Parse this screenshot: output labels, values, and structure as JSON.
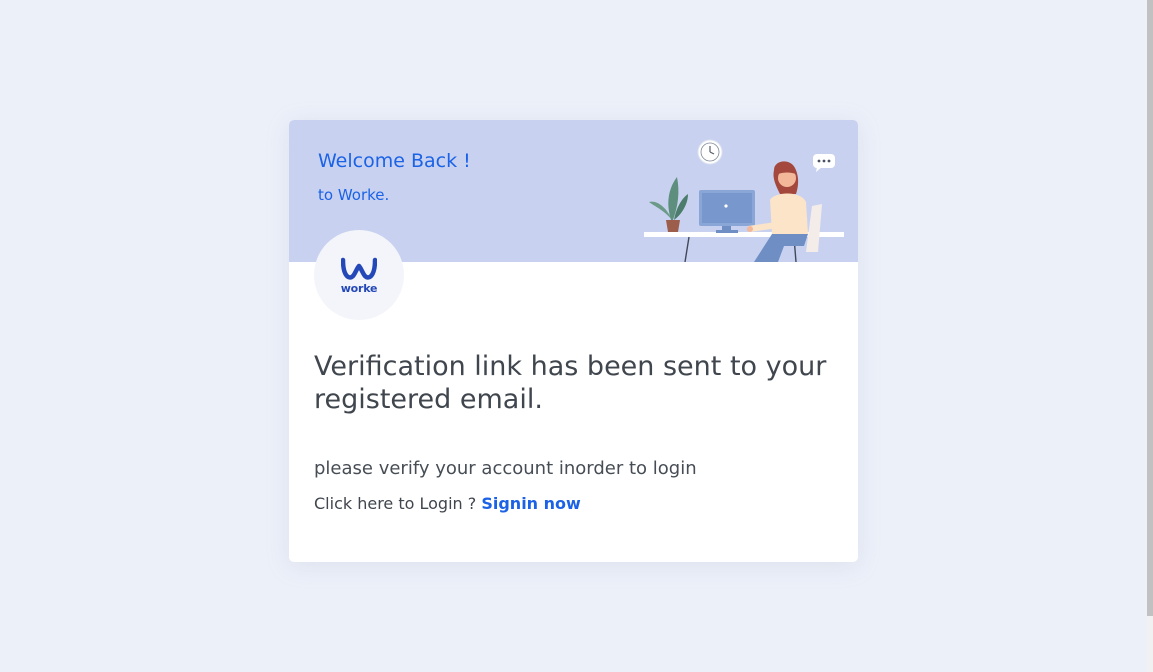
{
  "header": {
    "title": "Welcome Back !",
    "subtitle": "to Worke."
  },
  "logo": {
    "text": "worke",
    "icon": "worke-logo-icon"
  },
  "main": {
    "heading": "Verification link has been sent to your registered email.",
    "instruction": "please verify your account inorder to login",
    "login_prompt": "Click here to Login ?",
    "signin_link": "Signin now"
  },
  "colors": {
    "accent": "#1b62e6",
    "header_bg": "#c8d2f0",
    "page_bg": "#ecf0f9",
    "text": "#40464e"
  }
}
